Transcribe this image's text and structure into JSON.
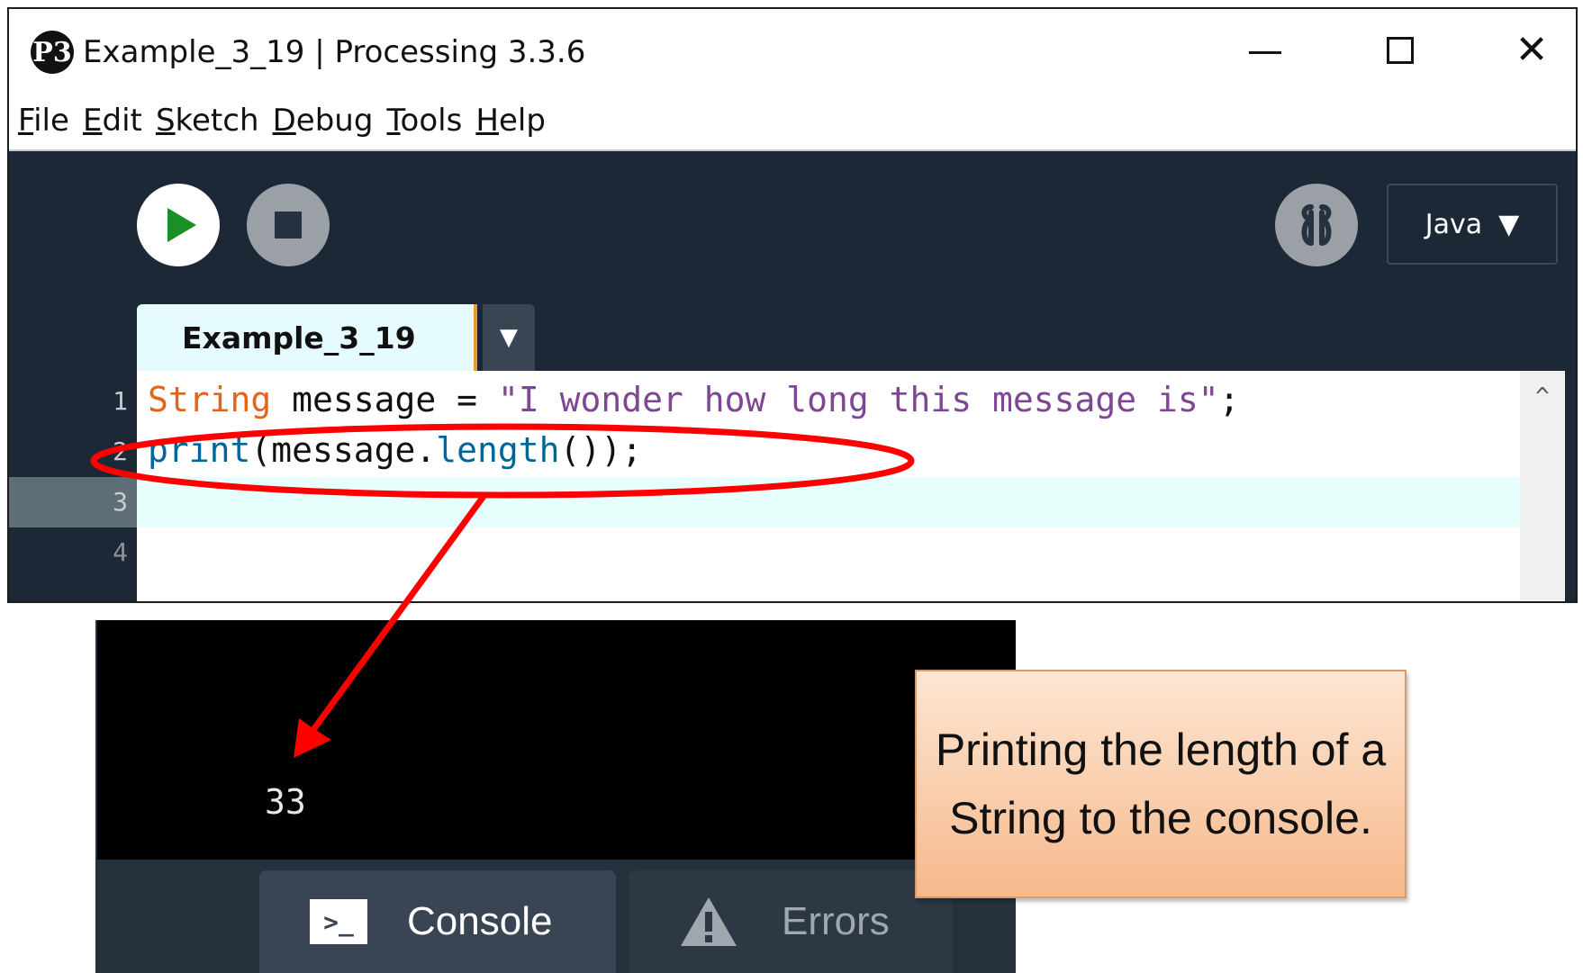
{
  "window": {
    "title": "Example_3_19 | Processing 3.3.6",
    "app_icon_glyph": "P3",
    "controls": {
      "minimize": "minimize-icon",
      "maximize": "maximize-icon",
      "close": "close-icon"
    }
  },
  "menubar": {
    "items": [
      {
        "mnemonic": "F",
        "rest": "ile"
      },
      {
        "mnemonic": "E",
        "rest": "dit"
      },
      {
        "mnemonic": "S",
        "rest": "ketch"
      },
      {
        "mnemonic": "D",
        "rest": "ebug"
      },
      {
        "mnemonic": "T",
        "rest": "ools"
      },
      {
        "mnemonic": "H",
        "rest": "elp"
      }
    ]
  },
  "toolbar": {
    "run_icon": "play-icon",
    "stop_icon": "stop-icon",
    "debug_icon": "debugger-icon",
    "mode": "Java",
    "mode_arrow": "▼"
  },
  "tabs": {
    "active": "Example_3_19",
    "menu_arrow": "▼"
  },
  "editor": {
    "line_numbers": [
      "1",
      "2",
      "3",
      "4"
    ],
    "lines": {
      "l1_type": "String",
      "l1_mid": " message = ",
      "l1_str": "\"I wonder how long this message is\"",
      "l1_end": ";",
      "l2_fn": "print",
      "l2_mid": "(message.",
      "l2_method": "length",
      "l2_end": "());"
    },
    "current_line": 3,
    "scroll_up_arrow": "^"
  },
  "console": {
    "output": "33",
    "tabs": {
      "console": "Console",
      "errors": "Errors"
    },
    "console_icon_glyph": ">_"
  },
  "annotation": {
    "callout_text": "Printing the length of a String to the console.",
    "highlight_color": "#ff0000",
    "callout_fill": "#f6b98c"
  },
  "colors": {
    "ide_background": "#1d2836",
    "keyword_type": "#e2661a",
    "string_literal": "#7d4793",
    "function_call": "#006699",
    "run_green": "#1a8f24",
    "tab_accent": "#e99b2c"
  }
}
